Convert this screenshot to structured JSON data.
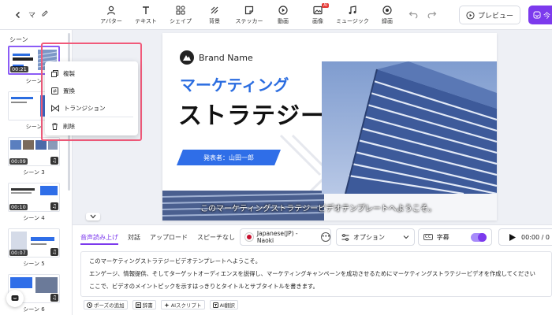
{
  "header": {
    "project_title": "マ",
    "tools": [
      {
        "label": "アバター",
        "icon": "avatar-icon"
      },
      {
        "label": "テキスト",
        "icon": "text-icon"
      },
      {
        "label": "シェイプ",
        "icon": "shapes-icon"
      },
      {
        "label": "背景",
        "icon": "background-icon"
      },
      {
        "label": "ステッカー",
        "icon": "sticker-icon"
      },
      {
        "label": "動画",
        "icon": "video-icon"
      },
      {
        "label": "画像",
        "icon": "image-icon",
        "badge": "AI"
      },
      {
        "label": "ミュージック",
        "icon": "music-icon"
      },
      {
        "label": "録画",
        "icon": "record-icon"
      }
    ],
    "preview_label": "プレビュー",
    "export_label": "今"
  },
  "scenes": {
    "heading": "シーン",
    "items": [
      {
        "label": "シーン",
        "duration": "00:21",
        "active": true
      },
      {
        "label": "シーン",
        "duration": ""
      },
      {
        "label": "シーン 3",
        "duration": "00:09"
      },
      {
        "label": "シーン 4",
        "duration": "00:10"
      },
      {
        "label": "シーン 5",
        "duration": "00:07"
      },
      {
        "label": "シーン 6",
        "duration": ""
      }
    ]
  },
  "context_menu": {
    "items": [
      {
        "label": "複製",
        "icon": "duplicate-icon"
      },
      {
        "label": "置換",
        "icon": "replace-icon"
      },
      {
        "label": "トランジション",
        "icon": "transition-icon"
      },
      {
        "label": "削除",
        "icon": "trash-icon"
      }
    ]
  },
  "canvas": {
    "brand_name": "Brand Name",
    "headline_1": "マーケティング",
    "headline_2": "ストラテジー",
    "presenter": "発表者：山田一郎",
    "caption": "このマーケティングストラテジービデオテンプレートへようこそ。"
  },
  "bottom": {
    "tabs": [
      "音声読み上げ",
      "対話",
      "アップロード",
      "スピーチなし"
    ],
    "active_tab": 0,
    "voice": "Japanese(JP) - Naoki",
    "options_label": "オプション",
    "subtitles_label": "字幕",
    "cc_label": "CC",
    "subtitles_on": true,
    "time": "00:00 / 0",
    "script_lines": [
      "このマーケティングストラテジービデオテンプレートへようこそ。",
      "エンゲージ、情報提供、そしてターゲットオーディエンスを説得し、マーケティングキャンペーンを成功させるためにマーケティングストラテジービデオを作成してください",
      "ここで、ビデオのメイントピックを示すはっきりとタイトルとサブタイトルを書きます。"
    ],
    "script_tools": [
      "ポーズの追加",
      "辞書",
      "AIスクリプト",
      "AI翻訳"
    ]
  },
  "colors": {
    "accent": "#7c3aed",
    "brand_blue": "#2b6de0",
    "highlight": "#f15a7a"
  }
}
